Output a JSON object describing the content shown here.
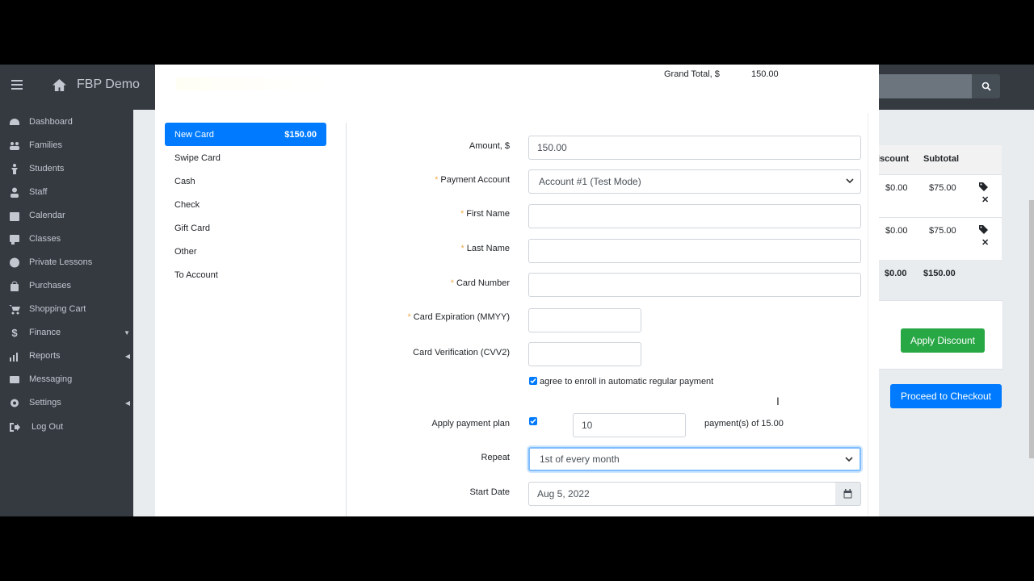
{
  "app": {
    "title": "FBP Demo"
  },
  "sidebar": {
    "items": [
      {
        "label": "Dashboard",
        "icon": "dashboard-icon"
      },
      {
        "label": "Families",
        "icon": "users-icon"
      },
      {
        "label": "Students",
        "icon": "student-icon"
      },
      {
        "label": "Staff",
        "icon": "user-icon"
      },
      {
        "label": "Calendar",
        "icon": "calendar-icon"
      },
      {
        "label": "Classes",
        "icon": "chalkboard-icon"
      },
      {
        "label": "Private Lessons",
        "icon": "user-circle-icon"
      },
      {
        "label": "Purchases",
        "icon": "shopping-bag-icon"
      },
      {
        "label": "Shopping Cart",
        "icon": "cart-icon"
      },
      {
        "label": "Finance",
        "icon": "dollar-icon"
      },
      {
        "label": "Reports",
        "icon": "chart-icon"
      },
      {
        "label": "Messaging",
        "icon": "envelope-icon"
      },
      {
        "label": "Settings",
        "icon": "gear-icon"
      },
      {
        "label": "Log Out",
        "icon": "logout-icon"
      }
    ]
  },
  "background": {
    "headers": {
      "discount": "iscount",
      "subtotal": "Subtotal"
    },
    "rows": [
      {
        "discount": "$0.00",
        "subtotal": "$75.00"
      },
      {
        "discount": "$0.00",
        "subtotal": "$75.00"
      }
    ],
    "totals": {
      "discount": "$0.00",
      "subtotal": "$150.00"
    },
    "apply_discount_label": "Apply Discount",
    "checkout_label": "Proceed to Checkout"
  },
  "modal": {
    "grand_total_label": "Grand Total, $",
    "grand_total_value": "150.00",
    "payment_methods": [
      {
        "label": "New Card",
        "amount": "$150.00",
        "active": true
      },
      {
        "label": "Swipe Card",
        "amount": ""
      },
      {
        "label": "Cash",
        "amount": ""
      },
      {
        "label": "Check",
        "amount": ""
      },
      {
        "label": "Gift Card",
        "amount": ""
      },
      {
        "label": "Other",
        "amount": ""
      },
      {
        "label": "To Account",
        "amount": ""
      }
    ],
    "form": {
      "amount_label": "Amount, $",
      "amount_value": "150.00",
      "payment_account_label": "Payment Account",
      "payment_account_value": "Account #1 (Test Mode)",
      "first_name_label": "First Name",
      "last_name_label": "Last Name",
      "card_number_label": "Card Number",
      "card_expiration_label": "Card Expiration (MMYY)",
      "card_cvv_label": "Card Verification (CVV2)",
      "auto_enroll_label": "agree to enroll in automatic regular payment",
      "payment_plan_label": "Apply payment plan",
      "payment_plan_count": "10",
      "payment_plan_suffix": "payment(s) of 15.00",
      "repeat_label": "Repeat",
      "repeat_value": "1st of every month",
      "start_date_label": "Start Date",
      "start_date_value": "Aug 5, 2022"
    }
  }
}
